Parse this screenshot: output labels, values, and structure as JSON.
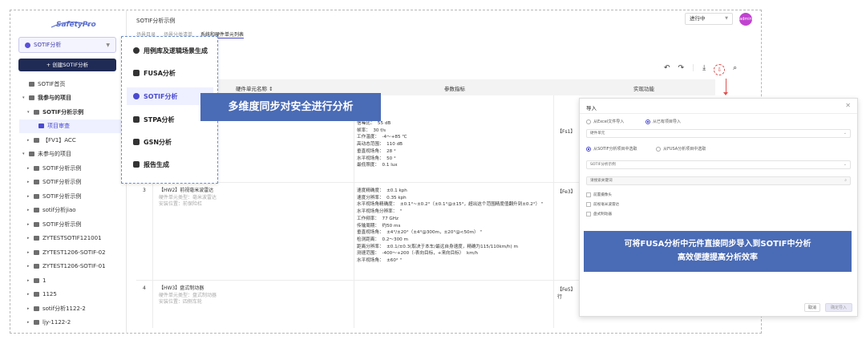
{
  "sidebar": {
    "logo_text": "SafetyPro",
    "project_select": "SOTIF分析",
    "create_button": "+ 创建SOTIF分析",
    "items": [
      {
        "label": "SOTIF首页",
        "arrow": "",
        "bold": false
      },
      {
        "label": "我参与的项目",
        "arrow": "▾",
        "bold": true
      },
      {
        "label": "SOTIF分析示例",
        "arrow": "▾",
        "bold": true
      },
      {
        "label": "项目审查",
        "arrow": "",
        "bold": false,
        "active": true
      },
      {
        "label": "【FV1】ACC",
        "arrow": "▸",
        "bold": false
      },
      {
        "label": "未参与的项目",
        "arrow": "▾",
        "bold": false
      },
      {
        "label": "SOTIF分析示例",
        "arrow": "▸",
        "bold": false
      },
      {
        "label": "SOTIF分析示例",
        "arrow": "▸",
        "bold": false
      },
      {
        "label": "SOTIF分析示例",
        "arrow": "▸",
        "bold": false
      },
      {
        "label": "sotif分析jiao",
        "arrow": "▸",
        "bold": false
      },
      {
        "label": "SOTIF分析示例",
        "arrow": "▸",
        "bold": false
      },
      {
        "label": "ZYTESTSOTIF121001",
        "arrow": "▸",
        "bold": false
      },
      {
        "label": "ZYTEST1206-SOTIF-02",
        "arrow": "▸",
        "bold": false
      },
      {
        "label": "ZYTEST1206-SOTIF-01",
        "arrow": "▸",
        "bold": false
      },
      {
        "label": "1",
        "arrow": "▸",
        "bold": false
      },
      {
        "label": "1125",
        "arrow": "▸",
        "bold": false
      },
      {
        "label": "sotif分析1122-2",
        "arrow": "▸",
        "bold": false
      },
      {
        "label": "ljy-1122-2",
        "arrow": "▸",
        "bold": false
      }
    ]
  },
  "header": {
    "title": "SOTIF分析示例",
    "tabs": [
      "场景目录",
      "场景分类清单",
      "系统和硬件单元列表"
    ],
    "status": "进行中",
    "avatar": "admin"
  },
  "table": {
    "columns": [
      "硬件单元名称 ↕",
      "参数指标",
      "实现功能"
    ],
    "rows": [
      {
        "num": "",
        "name": "",
        "sub1": "",
        "sub2": "",
        "params": "信噪比：  55 dB\n帧率：  30 f/s\n工作温度：  -4～+85 ℃\n高动态范围：  110 dB\n垂直视场角：  28 °\n水平视场角：  50 °\n最低照度：  0.1 lux",
        "func": "【Fs1】"
      },
      {
        "num": "3",
        "name": "【HW2】前视毫米波雷达",
        "sub1": "硬件单元类型：毫米波雷达",
        "sub2": "安装位置：前保险杠",
        "params": "速度精确度：  ±0.1 kph\n速度分辨率：  0.35 kph\n水平视场角精确度：  ±0.1°~±0.2°（±0.1°@±15°，超出这个范围精度值翻升到±0.2°） \"\n水平视场角分辨率：  \"\n工作频率：  77 GHz\n传输周期：  约50 ms\n垂直视场角：  ±4°/±20°（±4°@300m，±20°@<50m） \"\n检测距离：  0.2～300 m\n距离分辨率：  ±0.1/±0.3(取决于本车/最远自身速度，精确为115/110km/h) m\n测速范围：  -400～+200（-表向目标，+来向目标）  km/h\n水平视场角：  ±60° \"",
        "func": "【Fe3】"
      },
      {
        "num": "4",
        "name": "【HW3】盘式制动器",
        "sub1": "硬件单元类型：盘式制动器",
        "sub2": "安装位置：四侧车轮",
        "params": "",
        "func": "【Fe5】\n行"
      }
    ]
  },
  "menu": {
    "items": [
      {
        "label": "用例库及逻辑场景生成",
        "icon": "play-circle-icon"
      },
      {
        "label": "FUSA分析",
        "icon": "diagram-icon"
      },
      {
        "label": "SOTIF分析",
        "icon": "shield-icon",
        "active": true
      },
      {
        "label": "STPA分析",
        "icon": "stpa-icon"
      },
      {
        "label": "GSN分析",
        "icon": "gsn-icon"
      },
      {
        "label": "报告生成",
        "icon": "report-icon"
      }
    ]
  },
  "banners": {
    "sync": "多维度同步对安全进行分析",
    "import_line1": "可将FUSA分析中元件直接同步导入到SOTIF中分析",
    "import_line2": "高效便捷提高分析效率"
  },
  "dialog": {
    "title": "导入",
    "close": "✕",
    "radio_excel": "从Excel文件导入",
    "radio_other": "从已有项目导入",
    "type_select": "硬件单元",
    "radio_sotif": "从SOTIF分析项目中选取",
    "radio_fusa": "从FUSA分析项目中选取",
    "project_select": "SOTIF分析示例",
    "search_placeholder": "请搜索关键词",
    "checkboxes": [
      "前置摄像头",
      "前视毫米波雷达",
      "盘式制动器"
    ],
    "cancel": "取消",
    "confirm": "确定导入"
  }
}
